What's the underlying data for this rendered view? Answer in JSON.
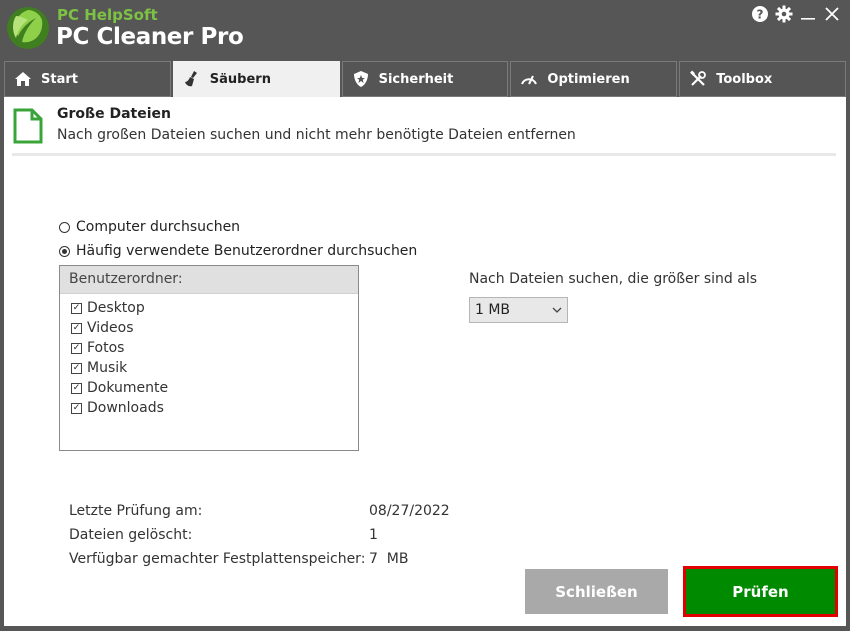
{
  "app": {
    "brand_top": "PC HelpSoft",
    "brand_main": "PC Cleaner Pro"
  },
  "titlebar": {
    "icons": [
      "help-icon",
      "gear-icon",
      "minimize-icon",
      "close-icon"
    ]
  },
  "tabs": [
    {
      "label": "Start",
      "icon": "home-icon",
      "active": false
    },
    {
      "label": "Säubern",
      "icon": "broom-icon",
      "active": true
    },
    {
      "label": "Sicherheit",
      "icon": "shield-icon",
      "active": false
    },
    {
      "label": "Optimieren",
      "icon": "gauge-icon",
      "active": false
    },
    {
      "label": "Toolbox",
      "icon": "tools-icon",
      "active": false
    }
  ],
  "header": {
    "title": "Große Dateien",
    "subtitle": "Nach großen Dateien suchen und nicht mehr benötigte Dateien entfernen",
    "accent_color": "#3aa43a"
  },
  "scan_options": {
    "option_computer": "Computer durchsuchen",
    "option_user_folders": "Häufig verwendete Benutzerordner durchsuchen",
    "selected": "option_user_folders"
  },
  "folders": {
    "header": "Benutzerordner:",
    "items": [
      {
        "label": "Desktop",
        "checked": true
      },
      {
        "label": "Videos",
        "checked": true
      },
      {
        "label": "Fotos",
        "checked": true
      },
      {
        "label": "Musik",
        "checked": true
      },
      {
        "label": "Dokumente",
        "checked": true
      },
      {
        "label": "Downloads",
        "checked": true
      }
    ]
  },
  "size_filter": {
    "label": "Nach Dateien suchen, die größer sind als",
    "selected_value": "1 MB"
  },
  "stats": {
    "last_scan_label": "Letzte Prüfung am:",
    "last_scan_value": "08/27/2022",
    "files_deleted_label": "Dateien gelöscht:",
    "files_deleted_value": "1",
    "freed_space_label": "Verfügbar gemachter Festplattenspeicher:",
    "freed_space_value": "7  MB"
  },
  "buttons": {
    "close_label": "Schließen",
    "scan_label": "Prüfen"
  },
  "colors": {
    "brand_green": "#7cc243",
    "scan_button": "#008a00",
    "scan_button_border": "#e00000",
    "close_button": "#a9a9a9",
    "chrome": "#565656"
  }
}
